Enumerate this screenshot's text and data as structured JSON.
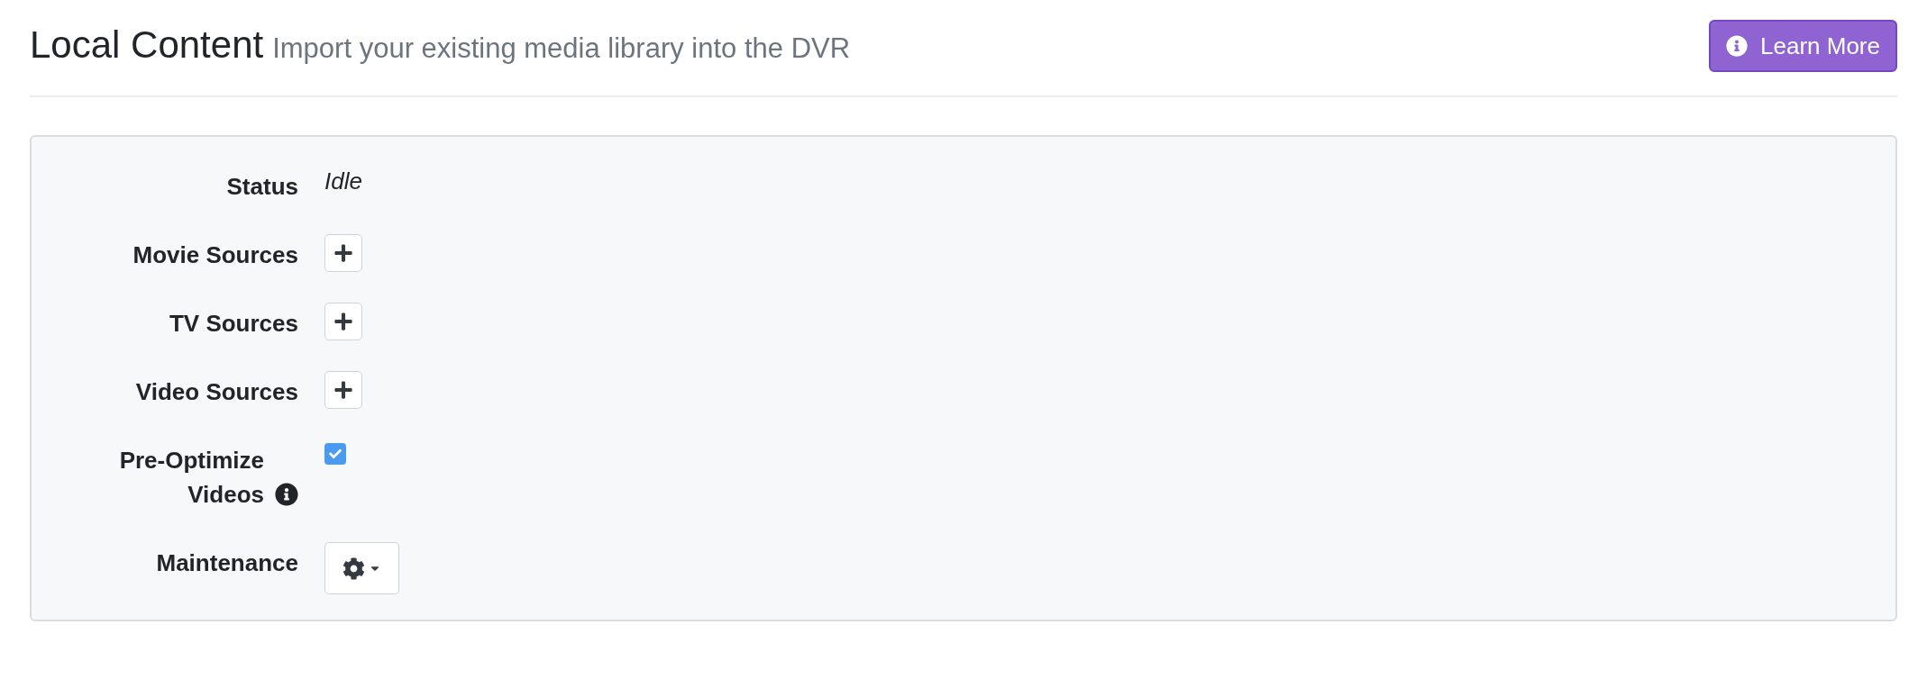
{
  "header": {
    "title": "Local Content",
    "subtitle": "Import your existing media library into the DVR",
    "learn_more_button": "Learn More"
  },
  "rows": [
    {
      "kind": "text",
      "label": "Status",
      "value": "Idle"
    },
    {
      "kind": "add",
      "label": "Movie Sources"
    },
    {
      "kind": "add",
      "label": "TV Sources"
    },
    {
      "kind": "add",
      "label": "Video Sources"
    },
    {
      "kind": "checkbox",
      "label": "Pre-Optimize Videos",
      "info": true,
      "checked": true
    },
    {
      "kind": "dropdown",
      "label": "Maintenance"
    }
  ]
}
